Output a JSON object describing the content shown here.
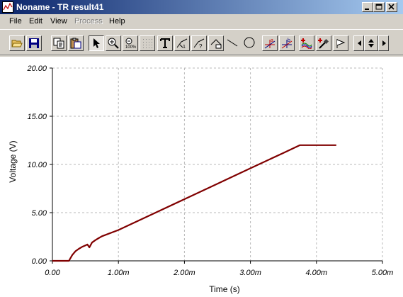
{
  "window": {
    "title": "Noname - TR result41"
  },
  "menu": {
    "file": "File",
    "edit": "Edit",
    "view": "View",
    "process": "Process",
    "help": "Help"
  },
  "toolbar": [
    "open-icon",
    "save-icon",
    "copy-icon",
    "paste-icon",
    "pointer-icon",
    "zoom-in-icon",
    "zoom-100-icon",
    "grid-icon",
    "text-icon",
    "cursor-a-icon",
    "cursor-b-icon",
    "auto-label-icon",
    "line-icon",
    "ellipse-icon",
    "marker-a-icon",
    "marker-b-icon",
    "add-curve-icon",
    "probe-icon",
    "flag-icon",
    "scroll-left-icon",
    "scroll-updown-icon",
    "scroll-right-icon"
  ],
  "chart_data": {
    "type": "line",
    "xlabel": "Time (s)",
    "ylabel": "Voltage (V)",
    "xlim": [
      0,
      0.005
    ],
    "ylim": [
      0,
      20
    ],
    "xticks": [
      "0.00",
      "1.00m",
      "2.00m",
      "3.00m",
      "4.00m",
      "5.00m"
    ],
    "yticks": [
      "0.00",
      "5.00",
      "10.00",
      "15.00",
      "20.00"
    ],
    "grid": true,
    "series": [
      {
        "color": "#800000",
        "x": [
          0,
          0.00025,
          0.0003,
          0.00035,
          0.0004,
          0.00045,
          0.0005,
          0.00053,
          0.00056,
          0.0006,
          0.00065,
          0.0007,
          0.00075,
          0.001,
          0.0015,
          0.002,
          0.0025,
          0.003,
          0.0035,
          0.00375,
          0.004,
          0.0043
        ],
        "y": [
          0,
          0,
          0.6,
          1.0,
          1.25,
          1.45,
          1.6,
          1.7,
          1.4,
          1.9,
          2.15,
          2.35,
          2.55,
          3.2,
          4.8,
          6.4,
          8.0,
          9.6,
          11.2,
          12.0,
          12.0,
          12.0
        ]
      }
    ]
  }
}
